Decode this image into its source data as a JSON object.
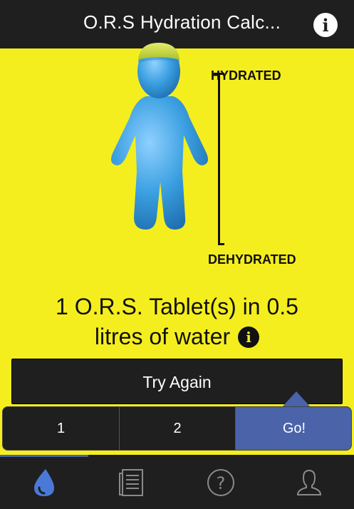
{
  "header": {
    "title": "O.R.S Hydration Calc...",
    "info_icon": "info-icon",
    "info_glyph": "i"
  },
  "meter": {
    "top_label": "HYDRATED",
    "bottom_label": "DEHYDRATED"
  },
  "figure": {
    "icon": "body-figure-icon",
    "color": "#3a9fe0",
    "head_band_color": "#c9d83a"
  },
  "result": {
    "line1": "1 O.R.S. Tablet(s) in 0.5",
    "line2": "litres of water",
    "info_glyph": "i"
  },
  "try_again": {
    "label": "Try Again"
  },
  "selector": {
    "options": [
      "1",
      "2"
    ],
    "go_label": "Go!"
  },
  "tabs": [
    {
      "icon": "water-drop-icon",
      "active": true
    },
    {
      "icon": "document-list-icon",
      "active": false
    },
    {
      "icon": "help-icon",
      "active": false
    },
    {
      "icon": "user-icon",
      "active": false
    }
  ],
  "colors": {
    "background": "#f5ee1e",
    "bar": "#1f1f1f",
    "accent": "#4a63a9"
  }
}
